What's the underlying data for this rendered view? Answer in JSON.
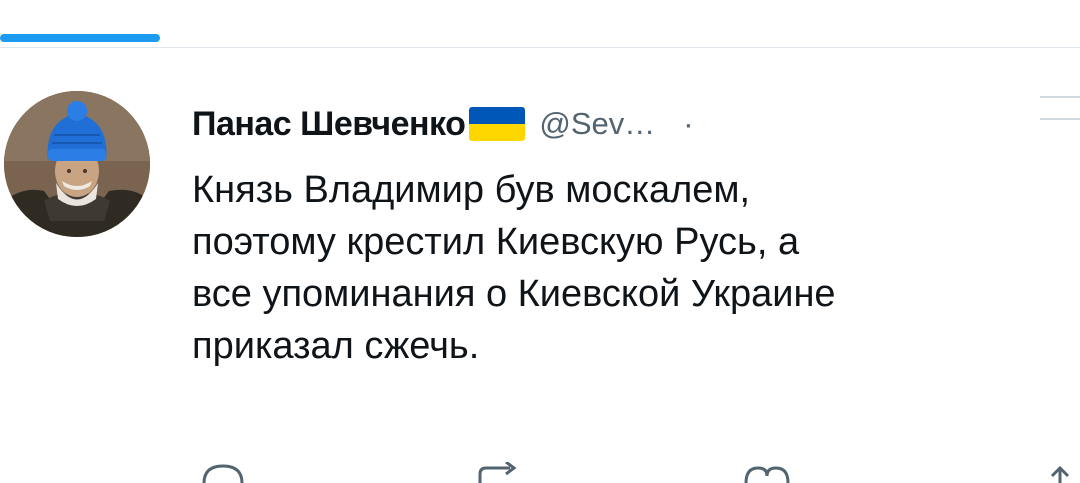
{
  "tweet": {
    "author": {
      "display_name": "Панас Шевченко",
      "handle": "@Sev…",
      "separator": "·",
      "badge_icon": "ukraine-flag-icon",
      "avatar_icon": "portrait-avatar"
    },
    "text_lines": [
      "Князь Владимир був москалем,",
      "поэтому крестил Киевскую Русь, а",
      "все упоминания о Киевской Украине",
      "приказал сжечь."
    ],
    "actions": {
      "reply_icon": "reply-icon",
      "retweet_icon": "retweet-icon",
      "like_icon": "heart-icon",
      "share_icon": "share-icon"
    }
  },
  "colors": {
    "accent": "#1d9bf0",
    "text_primary": "#0f1419",
    "text_secondary": "#536471",
    "divider": "#e1e8ed",
    "flag_blue": "#0057b7",
    "flag_yellow": "#ffd700"
  }
}
